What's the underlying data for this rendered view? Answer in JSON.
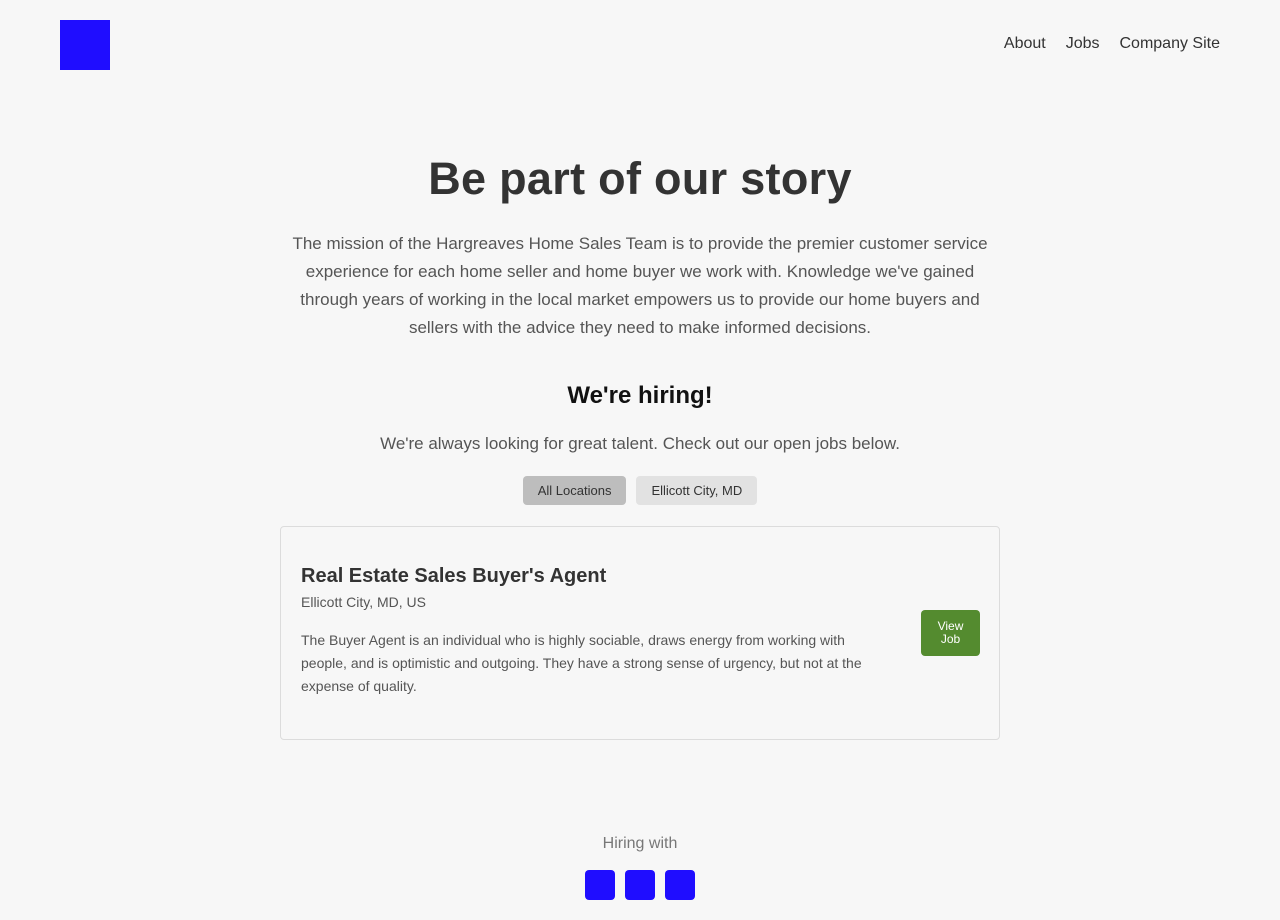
{
  "header": {
    "logo_color": "#1f0dff",
    "nav": [
      {
        "label": "About"
      },
      {
        "label": "Jobs"
      },
      {
        "label": "Company Site"
      }
    ]
  },
  "hero": {
    "headline": "Be part of our story",
    "mission": "The mission of the Hargreaves Home Sales Team is to provide the premier customer service experience for each home seller and home buyer we work with. Knowledge we've gained through years of working in the local market empowers us to provide our home buyers and sellers with the advice they need to make informed decisions."
  },
  "hiring": {
    "title": "We're hiring!",
    "subtitle": "We're always looking for great talent. Check out our open jobs below.",
    "filters": [
      {
        "label": "All Locations",
        "selected": true
      },
      {
        "label": "Ellicott City, MD",
        "selected": false
      }
    ]
  },
  "jobs": [
    {
      "title": "Real Estate Sales Buyer's Agent",
      "location": "Ellicott City, MD, US",
      "description": "The Buyer Agent is an individual who is highly sociable, draws energy from working with people, and is optimistic and outgoing. They have a strong sense of urgency, but not at the expense of quality.",
      "button_label": "View Job",
      "button_color": "#548b2f"
    }
  ],
  "footer": {
    "hiring_with": "Hiring with",
    "social_icon_color": "#1f0dff",
    "social_icons": [
      "social-icon-1",
      "social-icon-2",
      "social-icon-3"
    ]
  }
}
